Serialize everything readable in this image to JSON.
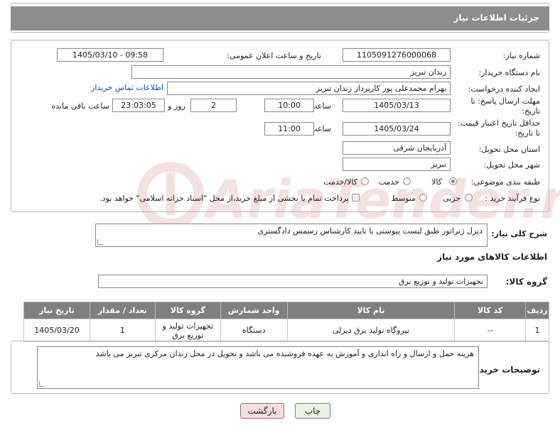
{
  "header": {
    "title": "جزئیات اطلاعات نیاز"
  },
  "form": {
    "need_number_label": "شماره نیاز:",
    "need_number": "1105091276000068",
    "announce_label": "تاریخ و ساعت اعلان عمومی:",
    "announce_value": "1405/03/10 - 09:58",
    "buyer_label": "نام دستگاه خریدار:",
    "buyer_value": "زندان تبریز",
    "creator_label": "ایجاد کننده درخواست:",
    "creator_value": "بهرام محمدعلی پور کارپرداز زندان تبریز",
    "contact_link": "اطلاعات تماس خریدار",
    "reply_label": "مهلت ارسال پاسخ: تا تاریخ:",
    "reply_date": "1405/03/13",
    "time_label": "ساعت",
    "reply_time": "10:00",
    "reply_days": "2",
    "days_label": "روز و",
    "reply_remaining": "23:03:05",
    "remaining_label": "ساعت باقی مانده",
    "validity_label": "حداقل تاریخ اعتبار قیمت: تا تاریخ:",
    "validity_date": "1405/03/24",
    "validity_time": "11:00",
    "province_label": "استان محل تحویل:",
    "province_value": "آذربایجان شرقی",
    "city_label": "شهر محل تحویل:",
    "city_value": "تبریز",
    "category_label": "طبقه بندی موضوعی:",
    "category_options": [
      "کالا",
      "خدمت",
      "کالا/خدمت"
    ],
    "category_selected": "کالا",
    "process_label": "نوع فرآیند خرید :",
    "process_options": [
      "جزیی",
      "متوسط"
    ],
    "payment_note": "پرداخت تمام یا بخشی از مبلغ خرید،از محل \"اسناد خزانه اسلامی\" خواهد بود."
  },
  "description": {
    "label": "شرح کلی نیاز:",
    "value": "دیزل ژنراتور طبق لیست پیوستی با تایید کارشناس رسمس دادگستری"
  },
  "goods": {
    "section_title": "اطلاعات کالاهای مورد نیاز",
    "group_label": "گروه کالا:",
    "group_value": "تجهیزات تولید و توزیع برق",
    "columns": [
      "ردیف",
      "کد کالا",
      "نام کالا",
      "واحد شمارش",
      "گروه کالا",
      "تعداد / مقدار",
      "تاریخ نیاز"
    ],
    "rows": [
      {
        "row": "1",
        "code": "--",
        "name": "نیروگاه تولید برق دیزلی",
        "unit": "دستگاه",
        "group": "تجهیزات تولید و توزیع برق",
        "qty": "1",
        "date": "1405/03/20"
      }
    ]
  },
  "buyer_notes": {
    "label": "توضیحات خریدار:",
    "value": "هزینه حمل و ارسال و راه اندازی و آموزش به عهده فروشنده می باشد و تحویل در محل زندان مرکزی تبریز می باشد"
  },
  "buttons": {
    "print": "چاپ",
    "back": "بازگشت"
  },
  "watermark": {
    "text": "AriaTender.net"
  },
  "colors": {
    "header_bg": "#8c8c8c",
    "table_header_bg": "#7f7f7f",
    "link": "#1a4fa0",
    "print_bg": "#e8f5e2",
    "back_bg": "#f8dede"
  }
}
